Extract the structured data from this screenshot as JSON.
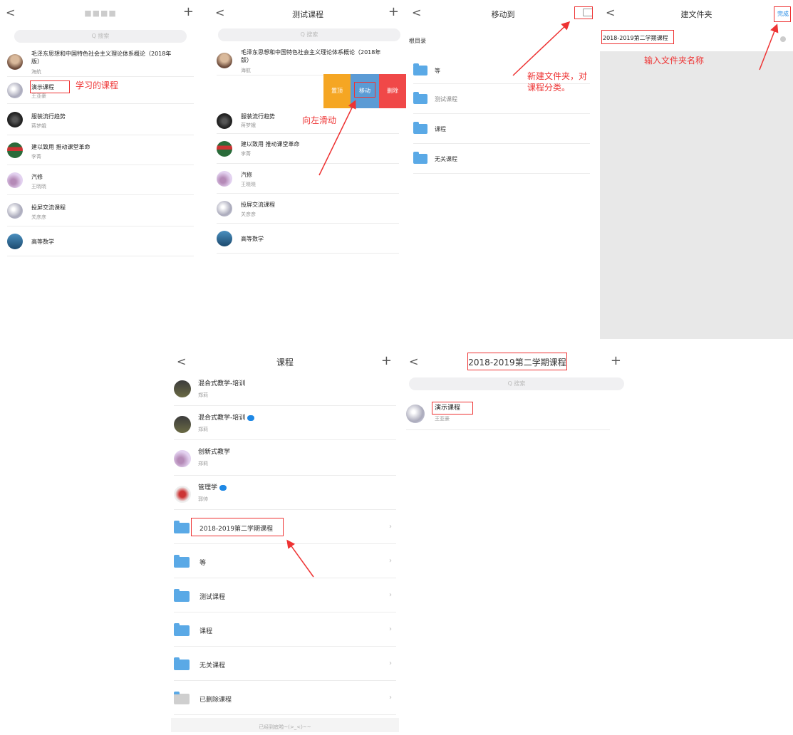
{
  "screen1": {
    "title": "■■■■",
    "plus": "+",
    "back": "<",
    "search": "Q 搜索",
    "courses": [
      {
        "name": "毛泽东思想和中国特色社会主义理论体系概论（2018年版）",
        "teacher": "海航"
      },
      {
        "name": "演示课程",
        "teacher": "王亚豪"
      },
      {
        "name": "服装流行趋势",
        "teacher": "蒋梦娥"
      },
      {
        "name": "建以致用 推动课堂革命",
        "teacher": "李菁"
      },
      {
        "name": "汽修",
        "teacher": "王晓晓"
      },
      {
        "name": "投屏交流课程",
        "teacher": "关彦彦"
      },
      {
        "name": "高等数学",
        "teacher": ""
      }
    ],
    "annotation": "学习的课程"
  },
  "screen2": {
    "title": "测试课程",
    "plus": "+",
    "back": "<",
    "search": "Q 搜索",
    "courses": [
      {
        "name": "毛泽东思想和中国特色社会主义理论体系概论（2018年版）",
        "teacher": "海航"
      },
      {
        "name": "服装流行趋势",
        "teacher": "蒋梦娥"
      },
      {
        "name": "建以致用 推动课堂革命",
        "teacher": "李菁"
      },
      {
        "name": "汽修",
        "teacher": "王晓晓"
      },
      {
        "name": "投屏交流课程",
        "teacher": "关彦彦"
      },
      {
        "name": "高等数学",
        "teacher": ""
      }
    ],
    "actions": {
      "top": "置顶",
      "move": "移动",
      "delete": "删除"
    },
    "annotation": "向左滑动"
  },
  "screen3": {
    "title": "移动到",
    "back": "<",
    "root": "根目录",
    "folders": [
      "等",
      "测试课程",
      "课程",
      "无关课程"
    ],
    "annotation_line1": "新建文件夹，对",
    "annotation_line2": "课程分类。"
  },
  "screen4": {
    "title": "建文件夹",
    "back": "<",
    "done": "完成",
    "input_value": "2018-2019第二学期课程",
    "annotation": "输入文件夹名称"
  },
  "screen5": {
    "title": "课程",
    "plus": "+",
    "back": "<",
    "courses": [
      {
        "name": "混合式教学-培训",
        "teacher": "郑莉",
        "badge": false
      },
      {
        "name": "混合式教学-培训",
        "teacher": "郑莉",
        "badge": true
      },
      {
        "name": "创新式教学",
        "teacher": "郑莉",
        "badge": false
      },
      {
        "name": "管理学",
        "teacher": "郭帅",
        "badge": true
      }
    ],
    "folders": [
      "2018-2019第二学期课程",
      "等",
      "测试课程",
      "课程",
      "无关课程",
      "已删除课程"
    ],
    "footer": "已经到底啦~(>_<)~~"
  },
  "screen6": {
    "title": "2018-2019第二学期课程",
    "plus": "+",
    "back": "<",
    "search": "Q 搜索",
    "course": {
      "name": "演示课程",
      "teacher": "王亚豪"
    }
  },
  "colors": {
    "accent_red": "#e33333",
    "folder_blue": "#5aa9e6",
    "move_blue": "#5b9bd5",
    "top_orange": "#f5a623",
    "delete_red": "#f04848",
    "done_blue": "#1e88e5"
  }
}
